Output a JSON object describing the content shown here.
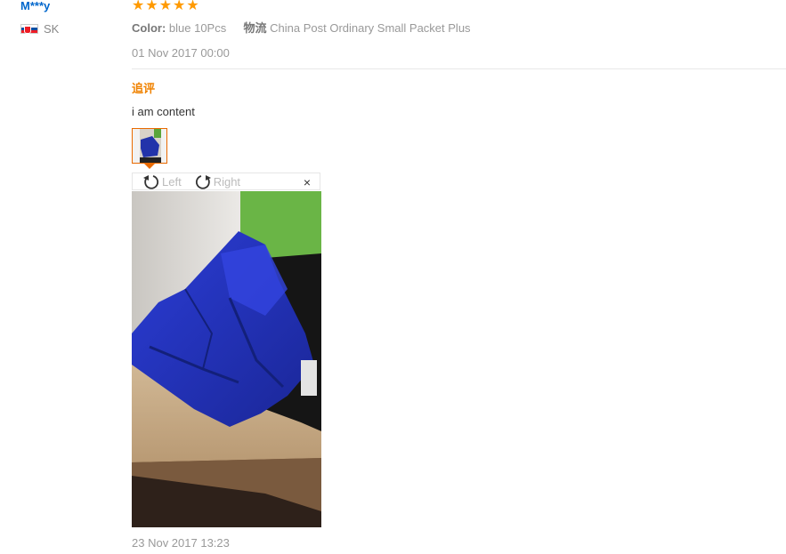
{
  "user": {
    "name": "M***y",
    "country": "SK"
  },
  "review": {
    "rating": 5,
    "color_label": "Color:",
    "color_value": "blue 10Pcs",
    "shipping_label": "物流",
    "shipping_value": "China Post Ordinary Small Packet Plus",
    "date": "01 Nov 2017 00:00",
    "additional_label": "追评",
    "content": "i am content",
    "additional_date": "23 Nov 2017 13:23"
  },
  "viewer": {
    "rotate_left": "Left",
    "rotate_right": "Right",
    "close": "×"
  },
  "icons": {
    "star": "★",
    "flag": "flag-slovakia-icon"
  },
  "colors": {
    "link": "#0066cc",
    "accent": "#ff9a00",
    "additional": "#f08200"
  }
}
